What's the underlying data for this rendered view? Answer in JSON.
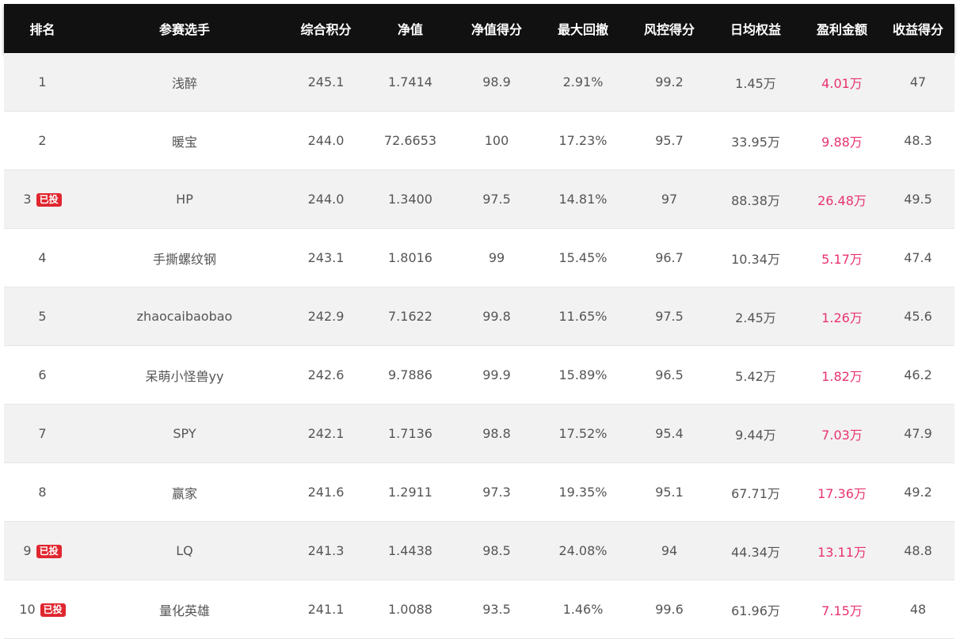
{
  "table": {
    "headers": [
      "排名",
      "参赛选手",
      "综合积分",
      "净值",
      "净值得分",
      "最大回撤",
      "风控得分",
      "日均权益",
      "盈利金额",
      "收益得分"
    ],
    "rows": [
      {
        "rank": "1",
        "badge": "",
        "player": "浅醉",
        "score": "245.1",
        "nav": "1.7414",
        "nav_score": "98.9",
        "max_drawdown": "2.91%",
        "risk_score": "99.2",
        "avg_equity": "1.45万",
        "profit": "4.01万",
        "return_score": "47"
      },
      {
        "rank": "2",
        "badge": "",
        "player": "暖宝",
        "score": "244.0",
        "nav": "72.6653",
        "nav_score": "100",
        "max_drawdown": "17.23%",
        "risk_score": "95.7",
        "avg_equity": "33.95万",
        "profit": "9.88万",
        "return_score": "48.3"
      },
      {
        "rank": "3",
        "badge": "已投",
        "player": "HP",
        "score": "244.0",
        "nav": "1.3400",
        "nav_score": "97.5",
        "max_drawdown": "14.81%",
        "risk_score": "97",
        "avg_equity": "88.38万",
        "profit": "26.48万",
        "return_score": "49.5"
      },
      {
        "rank": "4",
        "badge": "",
        "player": "手撕螺纹钢",
        "score": "243.1",
        "nav": "1.8016",
        "nav_score": "99",
        "max_drawdown": "15.45%",
        "risk_score": "96.7",
        "avg_equity": "10.34万",
        "profit": "5.17万",
        "return_score": "47.4"
      },
      {
        "rank": "5",
        "badge": "",
        "player": "zhaocaibaobao",
        "score": "242.9",
        "nav": "7.1622",
        "nav_score": "99.8",
        "max_drawdown": "11.65%",
        "risk_score": "97.5",
        "avg_equity": "2.45万",
        "profit": "1.26万",
        "return_score": "45.6"
      },
      {
        "rank": "6",
        "badge": "",
        "player": "呆萌小怪兽yy",
        "score": "242.6",
        "nav": "9.7886",
        "nav_score": "99.9",
        "max_drawdown": "15.89%",
        "risk_score": "96.5",
        "avg_equity": "5.42万",
        "profit": "1.82万",
        "return_score": "46.2"
      },
      {
        "rank": "7",
        "badge": "",
        "player": "SPY",
        "score": "242.1",
        "nav": "1.7136",
        "nav_score": "98.8",
        "max_drawdown": "17.52%",
        "risk_score": "95.4",
        "avg_equity": "9.44万",
        "profit": "7.03万",
        "return_score": "47.9"
      },
      {
        "rank": "8",
        "badge": "",
        "player": "赢家",
        "score": "241.6",
        "nav": "1.2911",
        "nav_score": "97.3",
        "max_drawdown": "19.35%",
        "risk_score": "95.1",
        "avg_equity": "67.71万",
        "profit": "17.36万",
        "return_score": "49.2"
      },
      {
        "rank": "9",
        "badge": "已投",
        "player": "LQ",
        "score": "241.3",
        "nav": "1.4438",
        "nav_score": "98.5",
        "max_drawdown": "24.08%",
        "risk_score": "94",
        "avg_equity": "44.34万",
        "profit": "13.11万",
        "return_score": "48.8"
      },
      {
        "rank": "10",
        "badge": "已投",
        "player": "量化英雄",
        "score": "241.1",
        "nav": "1.0088",
        "nav_score": "93.5",
        "max_drawdown": "1.46%",
        "risk_score": "99.6",
        "avg_equity": "61.96万",
        "profit": "7.15万",
        "return_score": "48"
      }
    ]
  },
  "colors": {
    "header_bg": "#111111",
    "header_text": "#ffffff",
    "row_alt_bg": "#f2f2f2",
    "profit_text": "#e8336d",
    "badge_bg": "#e0262f"
  }
}
